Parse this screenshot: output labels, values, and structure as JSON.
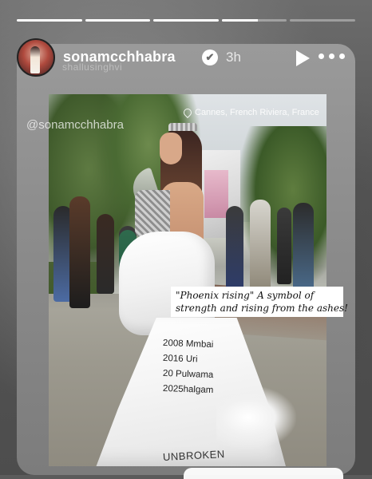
{
  "story": {
    "progress_segments": [
      1,
      1,
      1,
      0.55,
      0
    ],
    "username": "sonamcchhabra",
    "verified_mark": "✔",
    "time_ago": "3h",
    "faint_handle": "shallusinghvi",
    "icons": [
      "play-icon",
      "more-icon",
      "verified-icon"
    ]
  },
  "photo": {
    "location": "Cannes, French Riviera, France",
    "mention": "@sonamcchhabra",
    "caption_lines": [
      "\"Phoenix rising\" A symbol of",
      "strength and rising from the ashes!"
    ],
    "dress_lines": [
      "2008 Mmbai",
      "2016 Uri",
      "20 Pulwama",
      "2025halgam"
    ],
    "dress_bottom": "UNBROKEN"
  },
  "colors": {
    "accent": "#ffffff",
    "card_bg": "#8d8d8d",
    "backdrop": "#5b5b5b"
  }
}
